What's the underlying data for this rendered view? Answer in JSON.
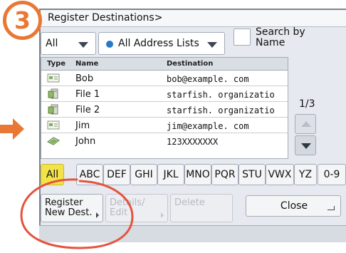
{
  "step_number": "3",
  "window": {
    "title": "Register Destinations>"
  },
  "filters": {
    "type_selected": "All",
    "address_list_selected": "All Address Lists",
    "search_by_name_label": "Search by Name"
  },
  "table": {
    "columns": [
      "Type",
      "Name",
      "Destination"
    ],
    "rows": [
      {
        "type_icon": "email-entry-icon",
        "name": "Bob",
        "destination": "bob@example. com"
      },
      {
        "type_icon": "file-server-icon",
        "name": "File 1",
        "destination": "starfish. organizatio"
      },
      {
        "type_icon": "file-server-icon",
        "name": "File 2",
        "destination": "starfish. organizatio"
      },
      {
        "type_icon": "email-entry-icon",
        "name": "Jim",
        "destination": "jim@example. com"
      },
      {
        "type_icon": "fax-entry-icon",
        "name": "John",
        "destination": "123XXXXXXX"
      }
    ]
  },
  "pager": {
    "page_text": "1/3"
  },
  "alpha_keys": [
    "All",
    "ABC",
    "DEF",
    "GHI",
    "JKL",
    "MNO",
    "PQR",
    "STU",
    "VWX",
    "YZ",
    "0-9"
  ],
  "alpha_selected": "All",
  "actions": {
    "register_label": "Register\nNew Dest.",
    "details_label": "Details/\nEdit",
    "delete_label": "Delete",
    "close_label": "Close"
  },
  "colors": {
    "badge_orange": "#e97834",
    "highlight_red": "#e5533f",
    "key_selected": "#f3e34a",
    "radio_blue": "#2a78c9"
  }
}
